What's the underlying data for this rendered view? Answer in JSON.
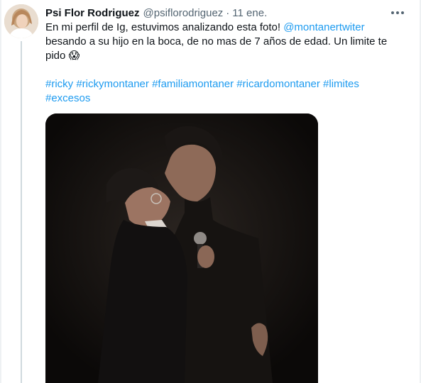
{
  "tweet": {
    "author_name": "Psi Flor Rodriguez",
    "handle": "@psiflorodriguez",
    "separator": "·",
    "date": "11 ene.",
    "text_part1": "En mi perfil de Ig, estuvimos analizando esta foto! ",
    "mention": "@montanertwiter",
    "text_part2": " besando a su hijo en la boca, de no mas de 7 años de edad. Un limite te pido ",
    "emoji": "😱",
    "hashtags": [
      "#ricky",
      "#rickymontaner",
      "#familiamontaner",
      "#ricardomontaner",
      "#limites",
      "#excesos"
    ]
  },
  "icons": {
    "more": "more-options-icon"
  },
  "colors": {
    "link": "#1d9bf0",
    "text": "#0f1419",
    "muted": "#536471",
    "thread_line": "#cfd9de"
  }
}
